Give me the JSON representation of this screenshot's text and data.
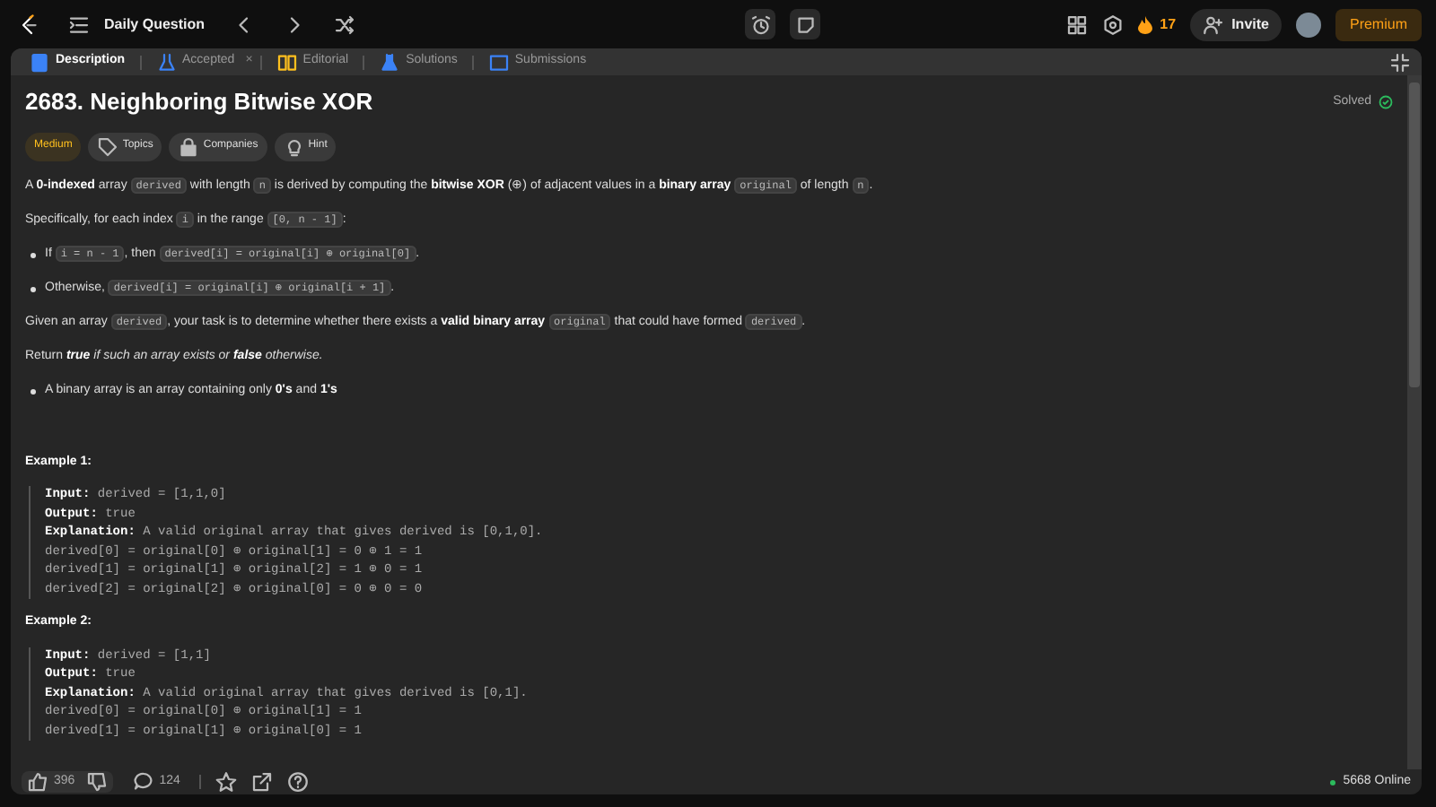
{
  "topbar": {
    "title": "Daily Question",
    "streak": "17",
    "invite": "Invite",
    "premium": "Premium"
  },
  "tabs": [
    {
      "label": "Description",
      "selected": true
    },
    {
      "label": "Accepted",
      "selected": false,
      "close": "×"
    },
    {
      "label": "Editorial",
      "selected": false
    },
    {
      "label": "Solutions",
      "selected": false
    },
    {
      "label": "Submissions",
      "selected": false
    }
  ],
  "problem": {
    "title": "2683. Neighboring Bitwise XOR",
    "status": "Solved",
    "difficulty": "Medium",
    "tags": [
      "Topics",
      "Companies",
      "Hint"
    ],
    "paragraphs": [
      {
        "kind": "p",
        "segments": [
          {
            "kind": "text",
            "text": "A **0-indexed** array "
          },
          {
            "kind": "code",
            "text": "derived"
          },
          {
            "kind": "text",
            "text": " with length "
          },
          {
            "kind": "code",
            "text": "n"
          },
          {
            "kind": "text",
            "text": " is derived by computing the **bitwise XOR** (⊕) of adjacent values in a **binary array** "
          },
          {
            "kind": "code",
            "text": "original"
          },
          {
            "kind": "text",
            "text": " of length "
          },
          {
            "kind": "code",
            "text": "n"
          },
          {
            "kind": "text",
            "text": "."
          }
        ]
      },
      {
        "kind": "p",
        "segments": [
          {
            "kind": "text",
            "text": "Specifically, for each index "
          },
          {
            "kind": "code",
            "text": "i"
          },
          {
            "kind": "text",
            "text": " in the range "
          },
          {
            "kind": "code",
            "text": "[0, n - 1]"
          },
          {
            "kind": "text",
            "text": ":"
          }
        ]
      },
      {
        "kind": "bullet",
        "segments": [
          {
            "kind": "text",
            "text": "If "
          },
          {
            "kind": "code",
            "text": "i = n - 1"
          },
          {
            "kind": "text",
            "text": ", then "
          },
          {
            "kind": "code",
            "text": "derived[i] = original[i] ⊕ original[0]"
          },
          {
            "kind": "text",
            "text": "."
          }
        ]
      },
      {
        "kind": "bullet",
        "segments": [
          {
            "kind": "text",
            "text": "Otherwise, "
          },
          {
            "kind": "code",
            "text": "derived[i] = original[i] ⊕ original[i + 1]"
          },
          {
            "kind": "text",
            "text": "."
          }
        ]
      },
      {
        "kind": "p",
        "segments": [
          {
            "kind": "text",
            "text": "Given an array "
          },
          {
            "kind": "code",
            "text": "derived"
          },
          {
            "kind": "text",
            "text": ", your task is to determine whether there exists a **valid binary array** "
          },
          {
            "kind": "code",
            "text": "original"
          },
          {
            "kind": "text",
            "text": " that could have formed "
          },
          {
            "kind": "code",
            "text": "derived"
          },
          {
            "kind": "text",
            "text": "."
          }
        ]
      },
      {
        "kind": "p",
        "segments": [
          {
            "kind": "text",
            "text": "Return "
          },
          {
            "kind": "em",
            "text": "**true** if such an array exists or **false** otherwise."
          }
        ]
      },
      {
        "kind": "bullet",
        "segments": [
          {
            "kind": "text",
            "text": "A binary array is an array containing only **0's** and **1's**"
          }
        ]
      }
    ],
    "examples": [
      {
        "heading": "Example 1:",
        "lines": [
          {
            "label": "Input:",
            "text": "derived = [1,1,0]"
          },
          {
            "label": "Output:",
            "text": "true"
          },
          {
            "label": "Explanation:",
            "text": "A valid original array that gives derived is [0,1,0]."
          },
          {
            "text": "derived[0] = original[0] ⊕ original[1] = 0 ⊕ 1 = 1"
          },
          {
            "text": "derived[1] = original[1] ⊕ original[2] = 1 ⊕ 0 = 1"
          },
          {
            "text": "derived[2] = original[2] ⊕ original[0] = 0 ⊕ 0 = 0"
          }
        ]
      },
      {
        "heading": "Example 2:",
        "lines": [
          {
            "label": "Input:",
            "text": "derived = [1,1]"
          },
          {
            "label": "Output:",
            "text": "true"
          },
          {
            "label": "Explanation:",
            "text": "A valid original array that gives derived is [0,1]."
          },
          {
            "text": "derived[0] = original[0] ⊕ original[1] = 1"
          },
          {
            "text": "derived[1] = original[1] ⊕ original[0] = 1"
          }
        ]
      }
    ]
  },
  "footer": {
    "likes": "396",
    "comments": "124",
    "online": "5668 Online"
  }
}
